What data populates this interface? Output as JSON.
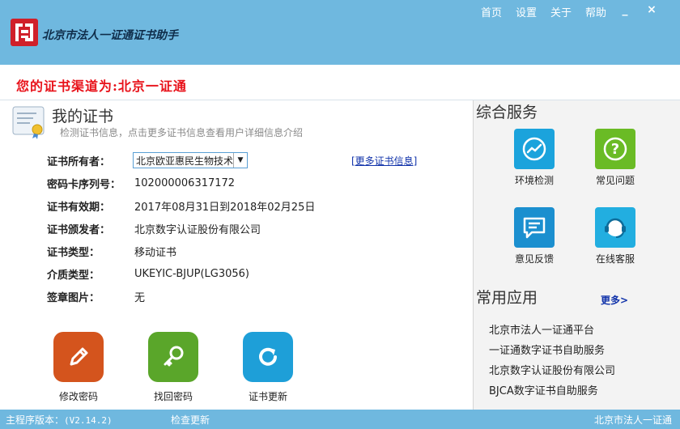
{
  "app": {
    "title": "北京市法人一证通证书助手",
    "nav": [
      "首页",
      "设置",
      "关于",
      "帮助"
    ],
    "minimize": "_",
    "close": "×"
  },
  "channel": {
    "text": "您的证书渠道为:北京一证通"
  },
  "my_cert": {
    "title": "我的证书",
    "subtitle": "检测证书信息，点击更多证书信息查看用户详细信息介绍",
    "more_link": "[更多证书信息]",
    "fields": [
      {
        "label": "证书所有者：",
        "value": "北京欧亚惠民生物技术"
      },
      {
        "label": "密码卡序列号：",
        "value": "102000006317172"
      },
      {
        "label": "证书有效期：",
        "value": "2017年08月31日到2018年02月25日"
      },
      {
        "label": "证书颁发者：",
        "value": "北京数字认证股份有限公司"
      },
      {
        "label": "证书类型：",
        "value": "移动证书"
      },
      {
        "label": "介质类型：",
        "value": "UKEYIC-BJUP(LG3056)"
      },
      {
        "label": "签章图片：",
        "value": "无"
      }
    ],
    "actions": [
      {
        "label": "修改密码",
        "color": "#d4541d"
      },
      {
        "label": "找回密码",
        "color": "#5aa62a"
      },
      {
        "label": "证书更新",
        "color": "#1e9fd8"
      }
    ]
  },
  "services": {
    "title": "综合服务",
    "items": [
      {
        "label": "环境检测",
        "color": "#1ba3dc"
      },
      {
        "label": "常见问题",
        "color": "#6abb25"
      },
      {
        "label": "意见反馈",
        "color": "#1b8fcf"
      },
      {
        "label": "在线客服",
        "color": "#22aee0"
      }
    ]
  },
  "apps": {
    "title": "常用应用",
    "more": "更多>",
    "items": [
      "北京市法人一证通平台",
      "一证通数字证书自助服务",
      "北京数字认证股份有限公司",
      "BJCA数字证书自助服务"
    ]
  },
  "status": {
    "version_label": "主程序版本：",
    "version": "(V2.14.2)",
    "check_update": "检查更新",
    "brand": "北京市法人一证通"
  }
}
